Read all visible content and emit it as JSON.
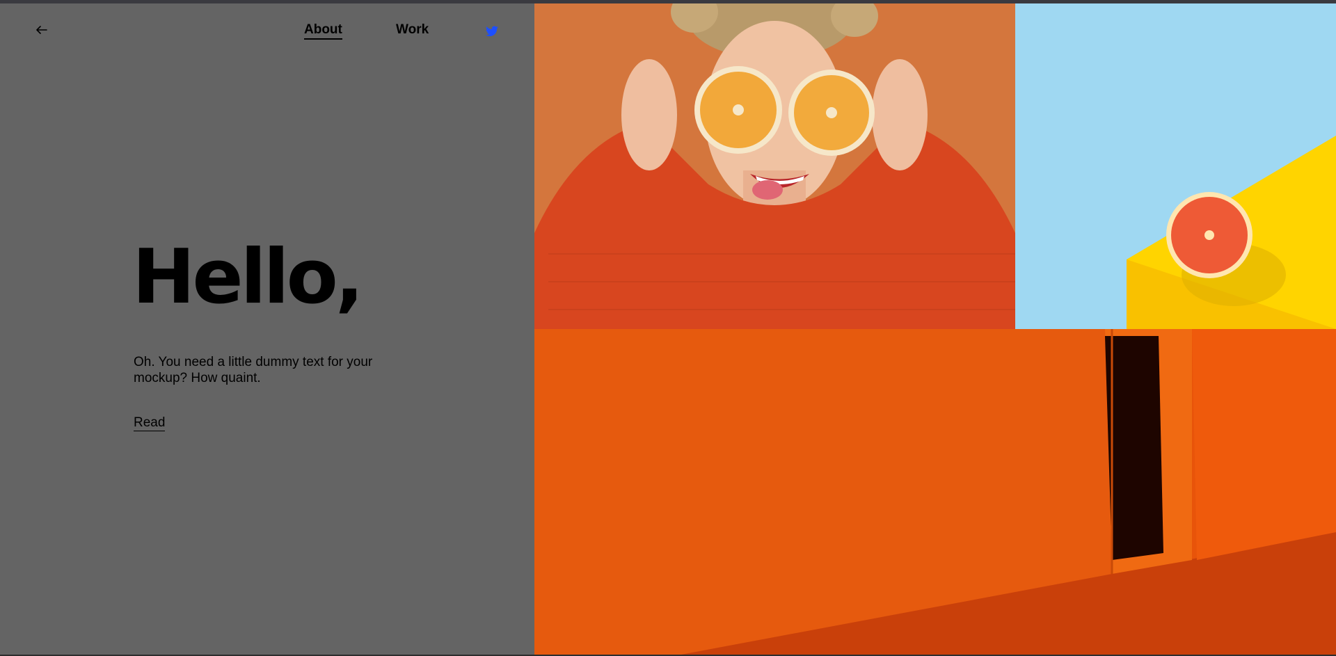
{
  "nav": {
    "about_label": "About",
    "work_label": "Work",
    "back_icon": "arrow-left-icon",
    "social_icon": "twitter-icon"
  },
  "hero": {
    "heading": "Hello,",
    "intro": "Oh. You need a little dummy text for your mockup? How quaint.",
    "read_label": "Read"
  },
  "colors": {
    "left_panel": "#646464",
    "text": "#000000",
    "twitter": "#1d4fff",
    "photo_orange": "#d97b3e",
    "sweater": "#d8461f",
    "sky_blue": "#9fd8f2",
    "yellow": "#ffd400",
    "wall_orange": "#e8540a"
  }
}
